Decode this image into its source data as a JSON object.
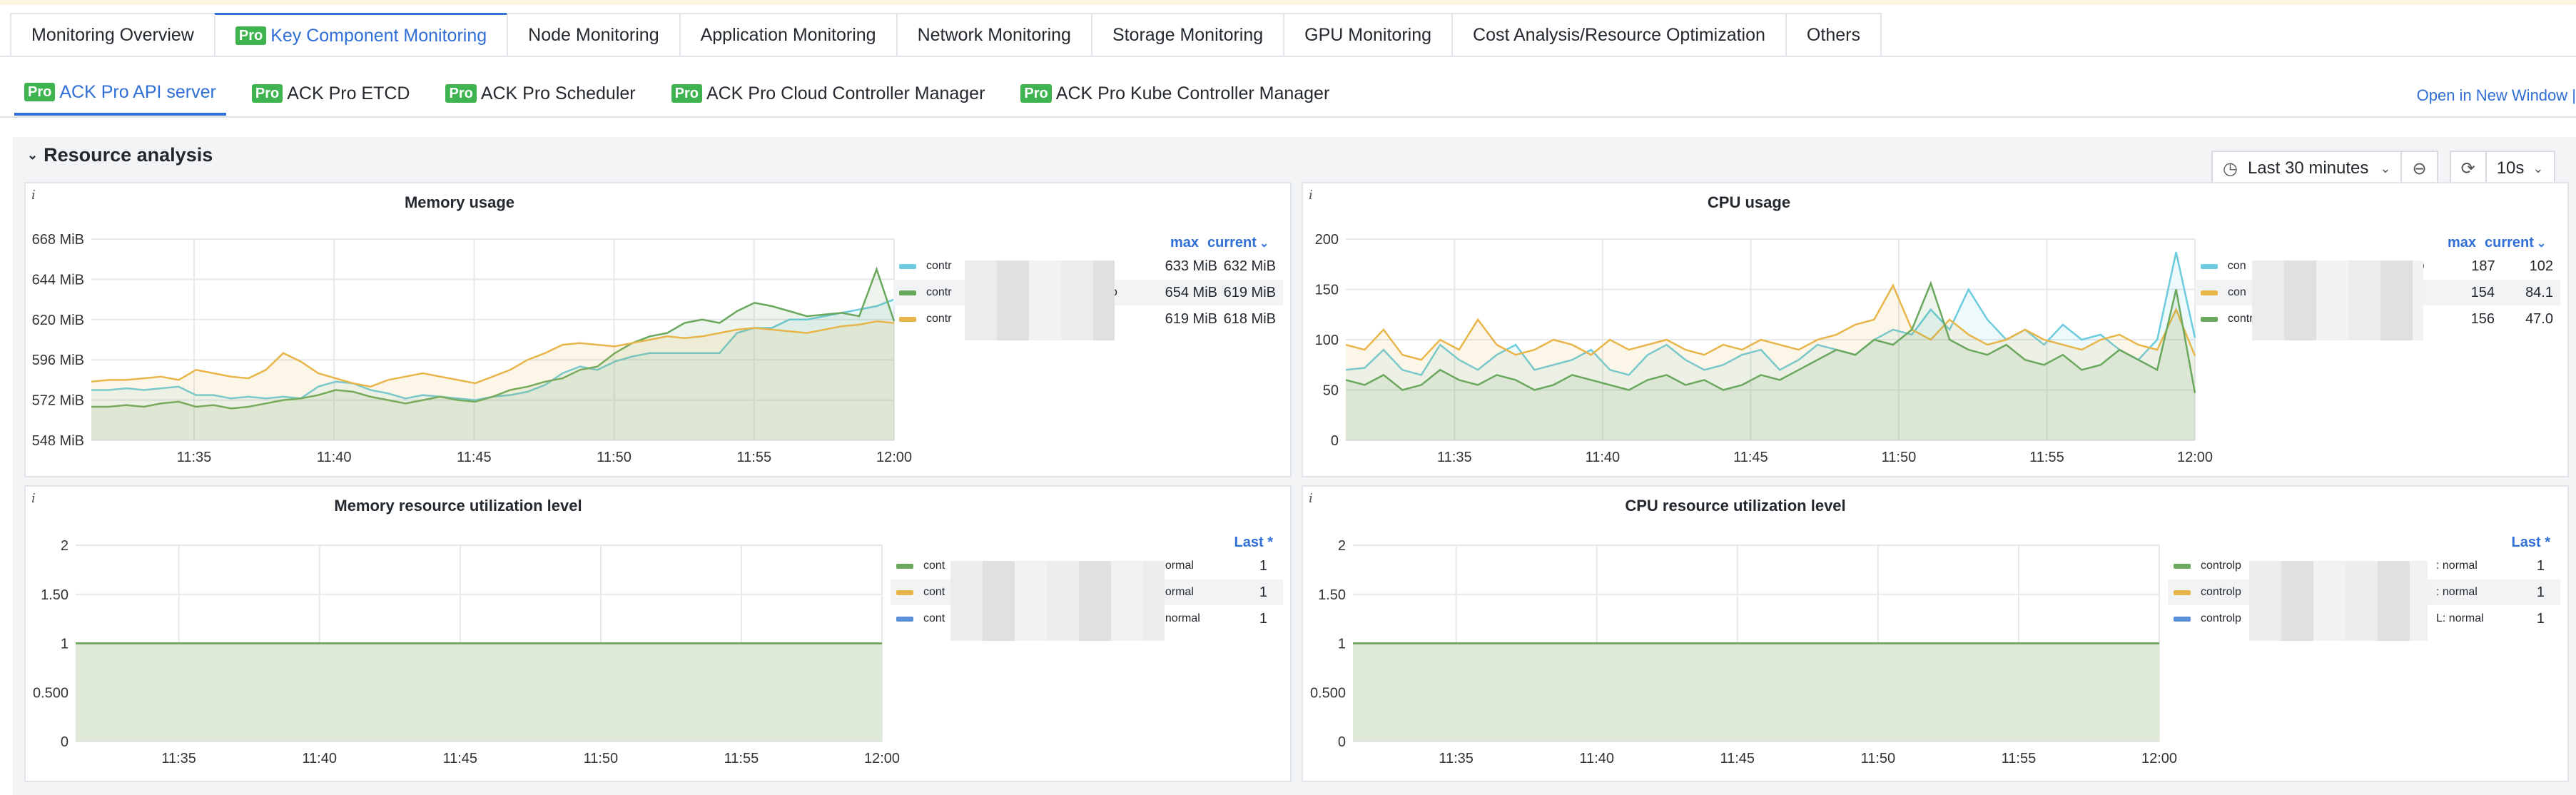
{
  "tabs_main": [
    {
      "label": "Monitoring Overview",
      "pro": false,
      "active": false
    },
    {
      "label": "Key Component Monitoring",
      "pro": true,
      "active": true
    },
    {
      "label": "Node Monitoring",
      "pro": false,
      "active": false
    },
    {
      "label": "Application Monitoring",
      "pro": false,
      "active": false
    },
    {
      "label": "Network Monitoring",
      "pro": false,
      "active": false
    },
    {
      "label": "Storage Monitoring",
      "pro": false,
      "active": false
    },
    {
      "label": "GPU Monitoring",
      "pro": false,
      "active": false
    },
    {
      "label": "Cost Analysis/Resource Optimization",
      "pro": false,
      "active": false
    },
    {
      "label": "Others",
      "pro": false,
      "active": false
    }
  ],
  "pro_badge": "Pro",
  "tabs_sub": [
    {
      "label": "ACK Pro API server",
      "active": true
    },
    {
      "label": "ACK Pro ETCD",
      "active": false
    },
    {
      "label": "ACK Pro Scheduler",
      "active": false
    },
    {
      "label": "ACK Pro Cloud Controller Manager",
      "active": false
    },
    {
      "label": "ACK Pro Kube Controller Manager",
      "active": false
    }
  ],
  "open_new_window": "Open in New Window |",
  "section_title": "Resource analysis",
  "time_range": "Last 30 minutes",
  "refresh_interval": "10s",
  "colors": {
    "cyan": "#6ccbdc",
    "green": "#6aa85e",
    "yellow": "#e8b54a",
    "blue": "#5a8fdc"
  },
  "chart_data": [
    {
      "type": "line",
      "title": "Memory usage",
      "yticks": [
        "668 MiB",
        "644 MiB",
        "620 MiB",
        "596 MiB",
        "572 MiB",
        "548 MiB"
      ],
      "ylim": [
        548,
        668
      ],
      "xticks": [
        "11:35",
        "11:40",
        "11:45",
        "11:50",
        "11:55",
        "12:00"
      ],
      "legend_headers": [
        "max",
        "current"
      ],
      "series": [
        {
          "label_start": "contr",
          "label_end": "x",
          "color": "#6ccbdc",
          "max": "633 MiB",
          "current": "632 MiB",
          "values": [
            578,
            578,
            579,
            578,
            579,
            580,
            575,
            575,
            573,
            574,
            573,
            574,
            573,
            580,
            583,
            582,
            578,
            576,
            573,
            575,
            574,
            573,
            572,
            574,
            575,
            577,
            581,
            588,
            592,
            590,
            595,
            598,
            600,
            600,
            600,
            600,
            600,
            612,
            615,
            615,
            620,
            620,
            622,
            624,
            626,
            628,
            632
          ]
        },
        {
          "label_start": "contr",
          "label_end": "9b",
          "color": "#6aa85e",
          "max": "654 MiB",
          "current": "619 MiB",
          "values": [
            568,
            568,
            569,
            568,
            570,
            571,
            568,
            569,
            567,
            568,
            570,
            572,
            573,
            575,
            578,
            577,
            574,
            572,
            570,
            572,
            574,
            572,
            571,
            574,
            578,
            580,
            583,
            585,
            590,
            592,
            600,
            606,
            610,
            612,
            618,
            620,
            618,
            625,
            630,
            628,
            625,
            622,
            623,
            624,
            622,
            650,
            619
          ]
        },
        {
          "label_start": "contr",
          "label_end": "r",
          "color": "#e8b54a",
          "max": "619 MiB",
          "current": "618 MiB",
          "values": [
            583,
            584,
            584,
            585,
            586,
            584,
            590,
            588,
            586,
            585,
            590,
            600,
            595,
            588,
            585,
            582,
            580,
            584,
            586,
            588,
            586,
            584,
            582,
            586,
            590,
            596,
            600,
            605,
            606,
            605,
            604,
            606,
            608,
            610,
            609,
            610,
            612,
            614,
            615,
            614,
            613,
            612,
            614,
            616,
            617,
            619,
            618
          ]
        }
      ]
    },
    {
      "type": "line",
      "title": "CPU usage",
      "yticks": [
        "200",
        "150",
        "100",
        "50",
        "0"
      ],
      "ylim": [
        0,
        200
      ],
      "xticks": [
        "11:35",
        "11:40",
        "11:45",
        "11:50",
        "11:55",
        "12:00"
      ],
      "legend_headers": [
        "max",
        "current"
      ],
      "series": [
        {
          "label_start": "con",
          "label_end": "9b",
          "color": "#6ccbdc",
          "max": "187",
          "current": "102",
          "values": [
            70,
            72,
            90,
            70,
            65,
            95,
            80,
            70,
            85,
            95,
            70,
            75,
            80,
            90,
            70,
            65,
            85,
            95,
            80,
            70,
            75,
            85,
            90,
            70,
            80,
            95,
            90,
            85,
            100,
            110,
            105,
            130,
            110,
            150,
            120,
            100,
            110,
            95,
            115,
            100,
            105,
            90,
            80,
            100,
            187,
            102
          ]
        },
        {
          "label_start": "con",
          "label_end": "r",
          "color": "#e8b54a",
          "max": "154",
          "current": "84.1",
          "values": [
            95,
            90,
            110,
            85,
            80,
            100,
            90,
            120,
            95,
            85,
            90,
            100,
            95,
            85,
            100,
            90,
            95,
            100,
            90,
            85,
            95,
            90,
            100,
            95,
            90,
            100,
            105,
            115,
            120,
            154,
            110,
            100,
            120,
            105,
            95,
            100,
            110,
            100,
            95,
            90,
            100,
            105,
            95,
            90,
            130,
            84
          ]
        },
        {
          "label_start": "controlp",
          "label_end": "",
          "color": "#6aa85e",
          "max": "156",
          "current": "47.0",
          "values": [
            60,
            55,
            65,
            50,
            55,
            70,
            60,
            55,
            65,
            60,
            50,
            55,
            65,
            60,
            55,
            50,
            60,
            65,
            55,
            60,
            50,
            55,
            65,
            60,
            70,
            80,
            90,
            85,
            100,
            95,
            110,
            156,
            100,
            90,
            85,
            95,
            80,
            75,
            85,
            70,
            75,
            90,
            80,
            70,
            150,
            47
          ]
        }
      ]
    },
    {
      "type": "area",
      "title": "Memory resource utilization level",
      "yticks": [
        "2",
        "1.50",
        "1",
        "0.500",
        "0"
      ],
      "ylim": [
        0,
        2
      ],
      "xticks": [
        "11:35",
        "11:40",
        "11:45",
        "11:50",
        "11:55",
        "12:00"
      ],
      "legend_headers": [
        "Last *"
      ],
      "series": [
        {
          "label_start": "cont",
          "label_end": "normal",
          "color": "#6aa85e",
          "last": "1",
          "value": 1
        },
        {
          "label_start": "cont",
          "label_end": "normal",
          "color": "#e8b54a",
          "last": "1",
          "value": 1
        },
        {
          "label_start": "cont",
          "label_end": ": normal",
          "color": "#5a8fdc",
          "last": "1",
          "value": 1
        }
      ]
    },
    {
      "type": "area",
      "title": "CPU resource utilization level",
      "yticks": [
        "2",
        "1.50",
        "1",
        "0.500",
        "0"
      ],
      "ylim": [
        0,
        2
      ],
      "xticks": [
        "11:35",
        "11:40",
        "11:45",
        "11:50",
        "11:55",
        "12:00"
      ],
      "legend_headers": [
        "Last *"
      ],
      "series": [
        {
          "label_start": "controlp",
          "label_end": ": normal",
          "color": "#6aa85e",
          "last": "1",
          "value": 1
        },
        {
          "label_start": "controlp",
          "label_end": ": normal",
          "color": "#e8b54a",
          "last": "1",
          "value": 1
        },
        {
          "label_start": "controlp",
          "label_end": "L: normal",
          "color": "#5a8fdc",
          "last": "1",
          "value": 1
        }
      ]
    }
  ]
}
